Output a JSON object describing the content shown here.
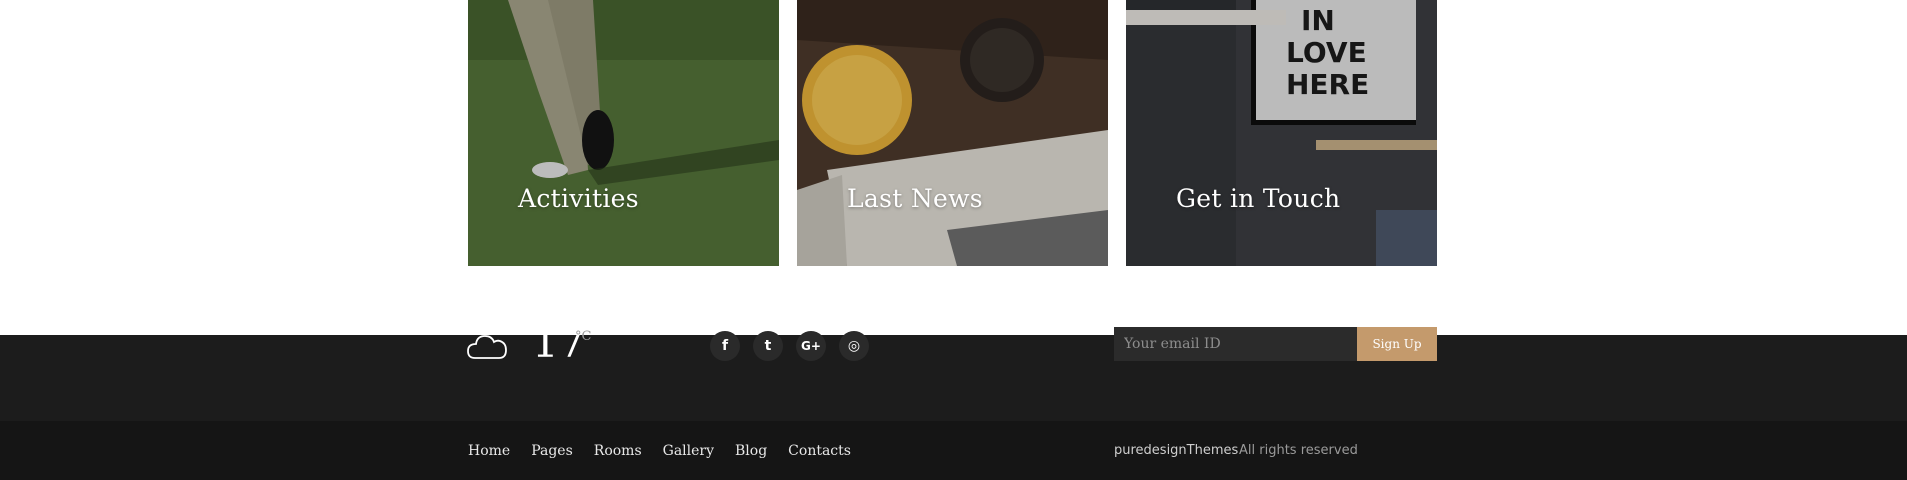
{
  "cards": [
    {
      "title": "Activities"
    },
    {
      "title": "Last News"
    },
    {
      "title": "Get in Touch"
    }
  ],
  "weather": {
    "icon": "cloud-icon",
    "temperature": "17",
    "unit": "°C"
  },
  "social": [
    {
      "icon": "facebook-icon",
      "glyph": "f"
    },
    {
      "icon": "twitter-icon",
      "glyph": "t"
    },
    {
      "icon": "google-plus-icon",
      "glyph": "G+"
    },
    {
      "icon": "instagram-icon",
      "glyph": "◎"
    }
  ],
  "newsletter": {
    "placeholder": "Your email ID",
    "button_label": "Sign Up"
  },
  "footer_nav": [
    "Home",
    "Pages",
    "Rooms",
    "Gallery",
    "Blog",
    "Contacts"
  ],
  "copyright": {
    "brand": "puredesignThemes",
    "rights": "All rights reserved"
  },
  "colors": {
    "accent": "#c49a6c",
    "footer_top": "#1c1c1c",
    "footer_bottom": "#151515"
  }
}
